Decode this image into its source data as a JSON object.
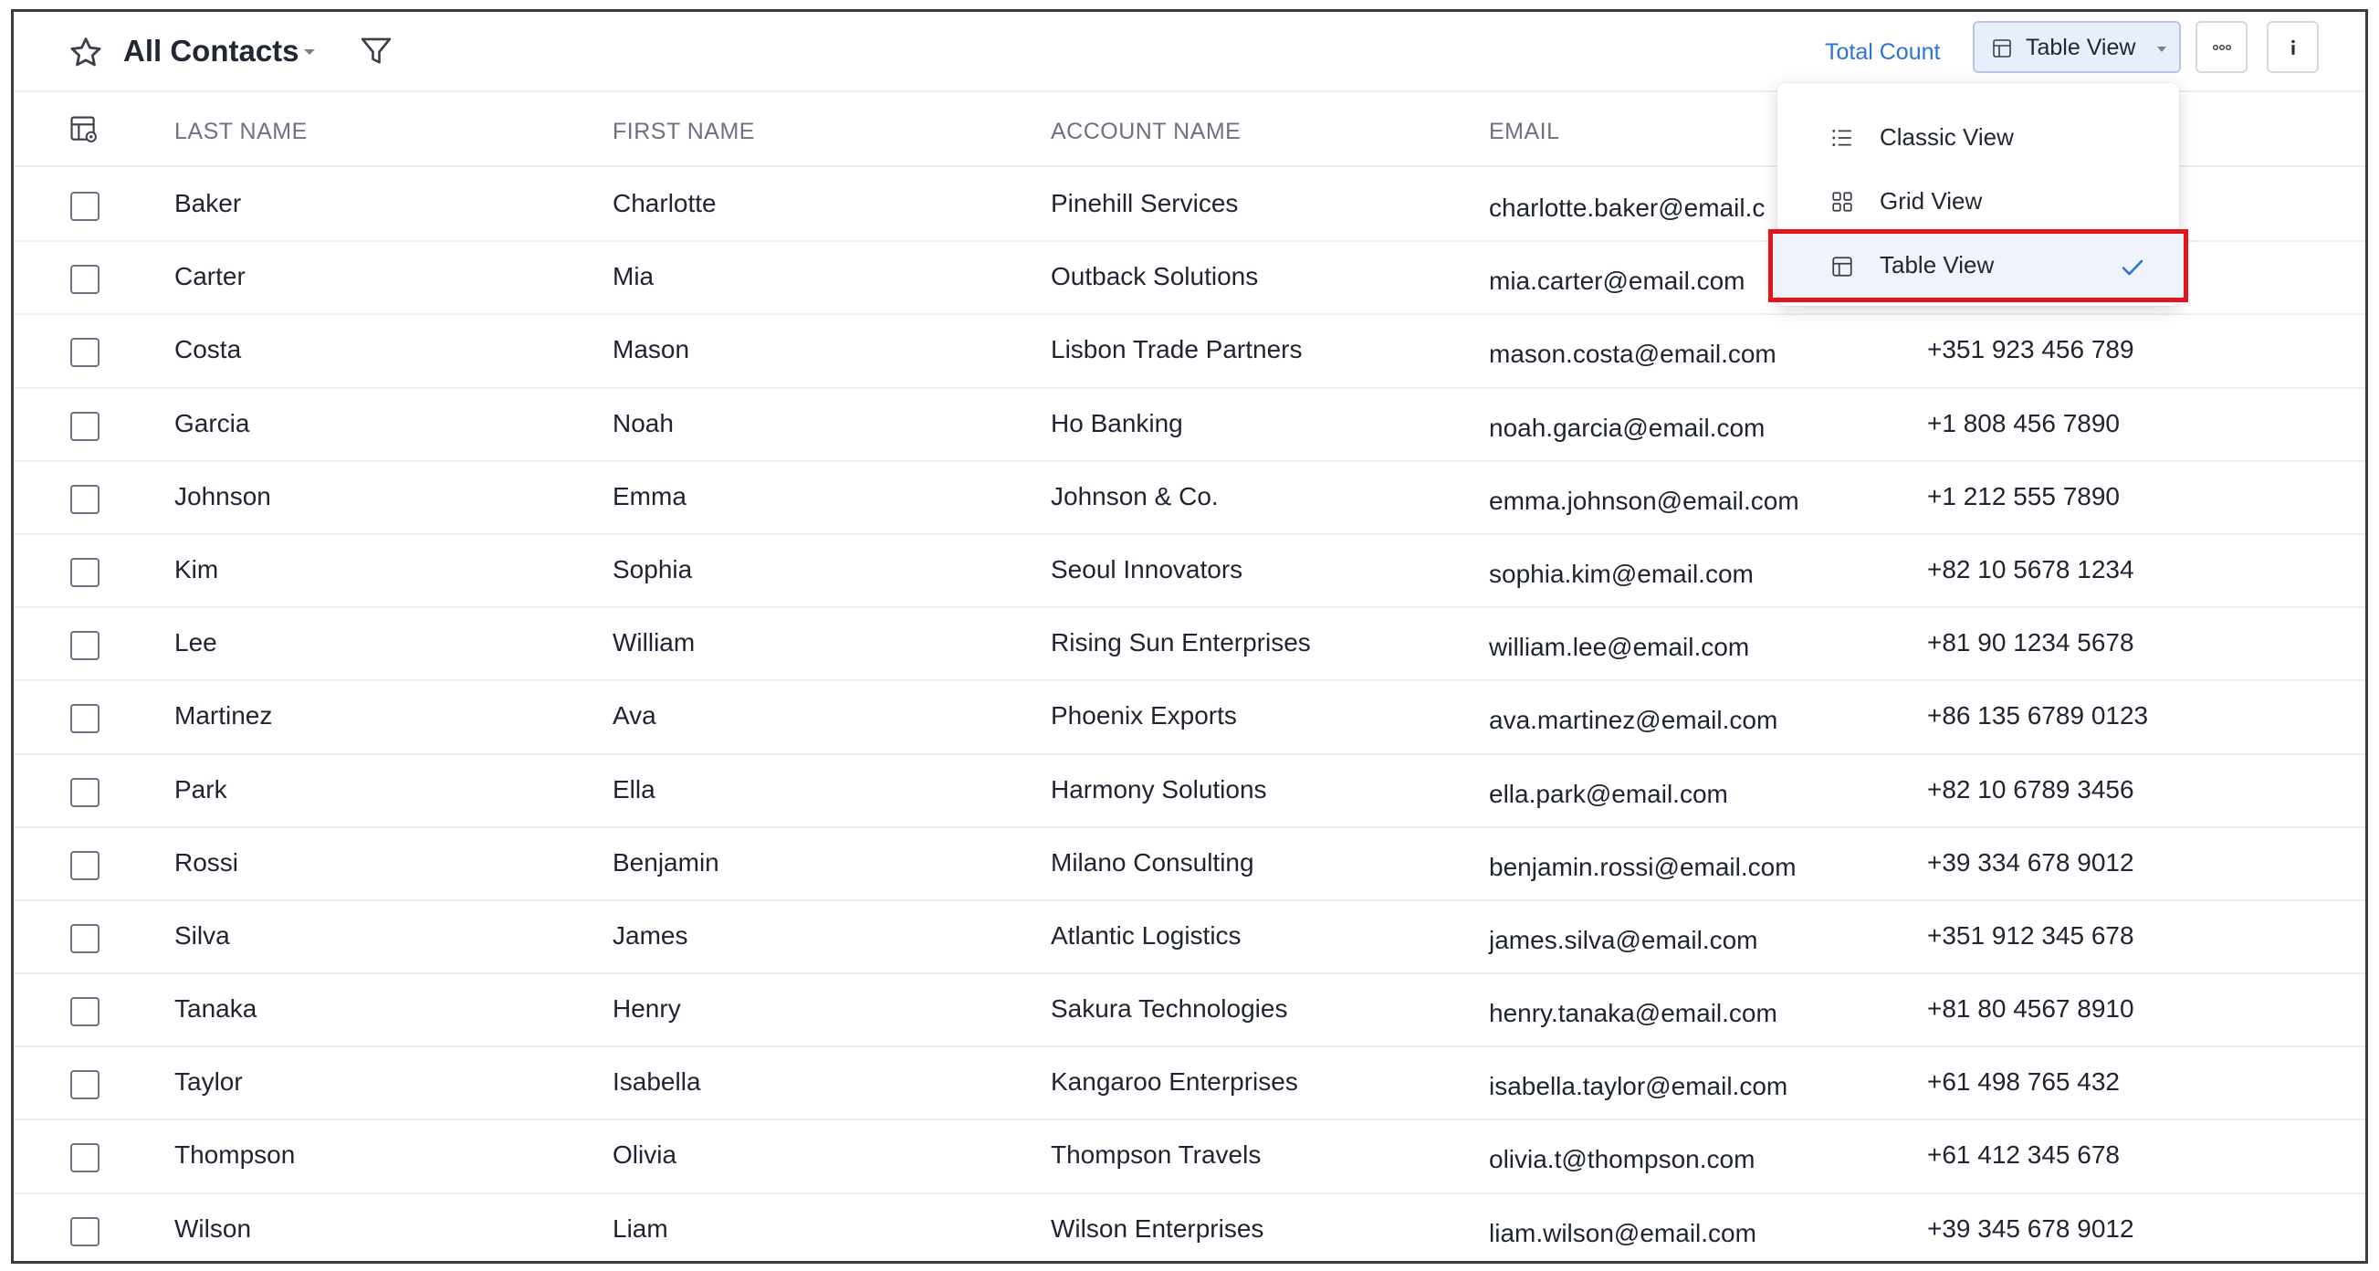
{
  "header": {
    "title": "All Contacts",
    "total_count_label": "Total Count",
    "view_button_label": "Table View",
    "accent_color": "#2f72d7"
  },
  "view_menu": {
    "items": [
      {
        "label": "Classic View",
        "icon": "list-icon",
        "selected": false
      },
      {
        "label": "Grid View",
        "icon": "grid-icon",
        "selected": false
      },
      {
        "label": "Table View",
        "icon": "table-icon",
        "selected": true
      }
    ],
    "highlight_color": "#e3141c"
  },
  "table": {
    "columns": [
      "LAST NAME",
      "FIRST NAME",
      "ACCOUNT NAME",
      "EMAIL"
    ],
    "rows": [
      {
        "last": "Baker",
        "first": "Charlotte",
        "account": "Pinehill Services",
        "email": "charlotte.baker@email.c",
        "phone": ""
      },
      {
        "last": "Carter",
        "first": "Mia",
        "account": "Outback Solutions",
        "email": "mia.carter@email.com",
        "phone": ""
      },
      {
        "last": "Costa",
        "first": "Mason",
        "account": "Lisbon Trade Partners",
        "email": "mason.costa@email.com",
        "phone": "+351 923 456 789"
      },
      {
        "last": "Garcia",
        "first": "Noah",
        "account": "Ho Banking",
        "email": "noah.garcia@email.com",
        "phone": "+1 808 456 7890"
      },
      {
        "last": "Johnson",
        "first": "Emma",
        "account": "Johnson & Co.",
        "email": "emma.johnson@email.com",
        "phone": "+1 212 555 7890"
      },
      {
        "last": "Kim",
        "first": "Sophia",
        "account": "Seoul Innovators",
        "email": "sophia.kim@email.com",
        "phone": "+82 10 5678 1234"
      },
      {
        "last": "Lee",
        "first": "William",
        "account": "Rising Sun Enterprises",
        "email": "william.lee@email.com",
        "phone": "+81 90 1234 5678"
      },
      {
        "last": "Martinez",
        "first": "Ava",
        "account": "Phoenix Exports",
        "email": "ava.martinez@email.com",
        "phone": "+86 135 6789 0123"
      },
      {
        "last": "Park",
        "first": "Ella",
        "account": "Harmony Solutions",
        "email": "ella.park@email.com",
        "phone": "+82 10 6789 3456"
      },
      {
        "last": "Rossi",
        "first": "Benjamin",
        "account": "Milano Consulting",
        "email": "benjamin.rossi@email.com",
        "phone": "+39 334 678 9012"
      },
      {
        "last": "Silva",
        "first": "James",
        "account": "Atlantic Logistics",
        "email": "james.silva@email.com",
        "phone": "+351 912 345 678"
      },
      {
        "last": "Tanaka",
        "first": "Henry",
        "account": "Sakura Technologies",
        "email": "henry.tanaka@email.com",
        "phone": "+81 80 4567 8910"
      },
      {
        "last": "Taylor",
        "first": "Isabella",
        "account": "Kangaroo Enterprises",
        "email": "isabella.taylor@email.com",
        "phone": "+61 498 765 432"
      },
      {
        "last": "Thompson",
        "first": "Olivia",
        "account": "Thompson Travels",
        "email": "olivia.t@thompson.com",
        "phone": "+61 412 345 678"
      },
      {
        "last": "Wilson",
        "first": "Liam",
        "account": "Wilson Enterprises",
        "email": "liam.wilson@email.com",
        "phone": "+39 345 678 9012"
      }
    ]
  }
}
